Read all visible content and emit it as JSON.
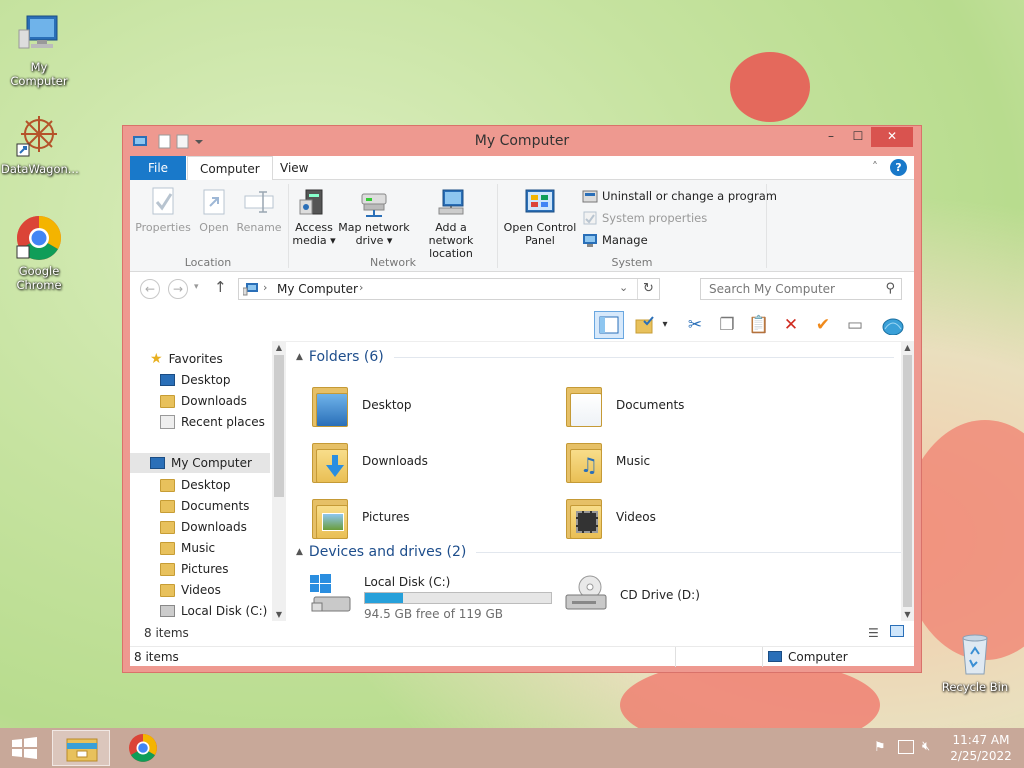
{
  "desktop": {
    "icons": [
      {
        "label": "My Computer"
      },
      {
        "label": "DataWagon..."
      },
      {
        "label": "Google Chrome"
      },
      {
        "label": "Recycle Bin"
      }
    ]
  },
  "window": {
    "title": "My Computer",
    "controls": {
      "minimize": "–",
      "maximize": "☐",
      "close": "✕"
    },
    "tabs": {
      "file": "File",
      "computer": "Computer",
      "view": "View"
    },
    "ribbon": {
      "location": {
        "label": "Location",
        "properties": "Properties",
        "open": "Open",
        "rename": "Rename"
      },
      "network": {
        "label": "Network",
        "access_media_1": "Access",
        "access_media_2": "media ▾",
        "map_drive_1": "Map network",
        "map_drive_2": "drive ▾",
        "add_location_1": "Add a network",
        "add_location_2": "location"
      },
      "system": {
        "label": "System",
        "open_cp_1": "Open Control",
        "open_cp_2": "Panel",
        "uninstall": "Uninstall or change a program",
        "sys_props": "System properties",
        "manage": "Manage"
      }
    },
    "address": {
      "path": "My Computer",
      "search_placeholder": "Search My Computer"
    },
    "nav_pane": {
      "favorites": "Favorites",
      "fav_items": [
        "Desktop",
        "Downloads",
        "Recent places"
      ],
      "computer": "My Computer",
      "pc_items": [
        "Desktop",
        "Documents",
        "Downloads",
        "Music",
        "Pictures",
        "Videos",
        "Local Disk (C:)"
      ],
      "count": "8 items"
    },
    "content": {
      "folders_header": "Folders (6)",
      "folders": [
        "Desktop",
        "Documents",
        "Downloads",
        "Music",
        "Pictures",
        "Videos"
      ],
      "devices_header": "Devices and drives (2)",
      "local_disk": {
        "name": "Local Disk (C:)",
        "free": "94.5 GB free of 119 GB",
        "used_fraction": 0.206
      },
      "cd_drive": {
        "name": "CD Drive (D:)"
      }
    },
    "status": {
      "items": "8 items",
      "computer": "Computer"
    }
  },
  "taskbar": {
    "time": "11:47 AM",
    "date": "2/25/2022"
  },
  "colors": {
    "accent": "#1979ca",
    "window_frame": "#ee9990",
    "close": "#d9534f"
  }
}
